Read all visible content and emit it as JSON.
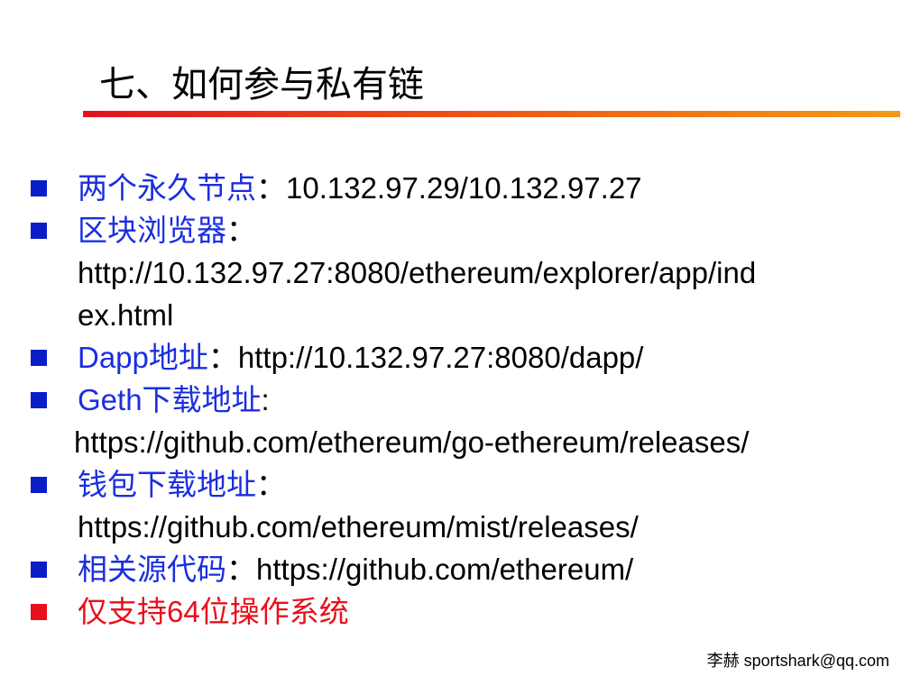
{
  "title": "七、如何参与私有链",
  "items": [
    {
      "label": "两个永久节点",
      "sep": "：",
      "line1": "10.132.97.29/10.132.97.27",
      "line2": ""
    },
    {
      "label": "区块浏览器",
      "sep": "：",
      "line1": "",
      "line2": "http://10.132.97.27:8080/ethereum/explorer/app/ind",
      "line3": "ex.html"
    },
    {
      "label": "Dapp地址",
      "sep": "：",
      "line1": "http://10.132.97.27:8080/dapp/"
    },
    {
      "label": "Geth下载地址",
      "sep": ":",
      "line2": "https://github.com/ethereum/go-ethereum/releases/"
    },
    {
      "label": "钱包下载地址",
      "sep": "：",
      "line2": "https://github.com/ethereum/mist/releases/"
    },
    {
      "label": "相关源代码",
      "sep": "：",
      "line1": "https://github.com/ethereum/"
    },
    {
      "label": "仅支持64位操作系统"
    }
  ],
  "footer": "李赫 sportshark@qq.com",
  "colors": {
    "label_blue": "#1a2ee0",
    "bullet_blue": "#0a1ec8",
    "highlight_red": "#e8101c",
    "rule_start": "#e0141e",
    "rule_end": "#f39a17"
  }
}
